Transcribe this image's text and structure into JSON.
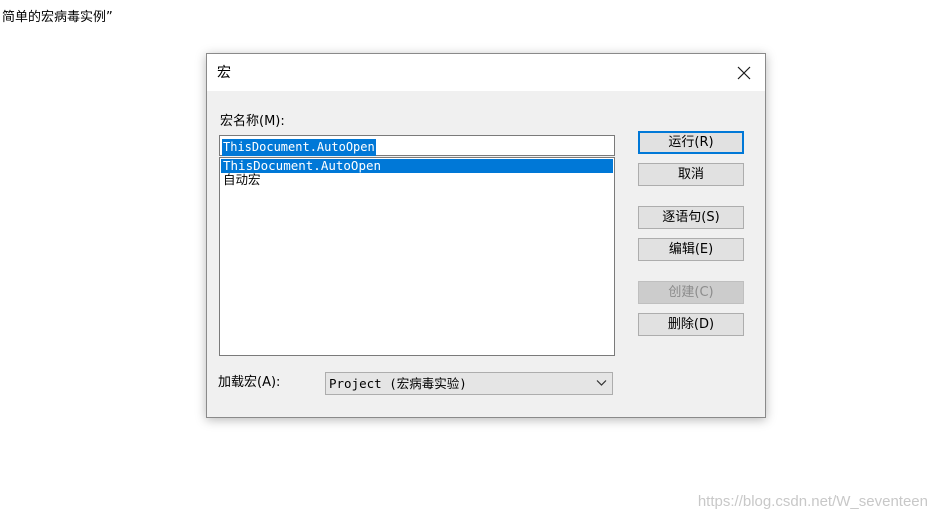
{
  "page": {
    "caption": "简单的宏病毒实例”",
    "watermark": "https://blog.csdn.net/W_seventeen"
  },
  "dialog": {
    "title": "宏",
    "close_icon": "close-icon",
    "macro_name_label": "宏名称(M):",
    "macro_name_value": "ThisDocument.AutoOpen",
    "macro_list": [
      {
        "label": "ThisDocument.AutoOpen",
        "selected": true
      },
      {
        "label": "自动宏",
        "selected": false
      }
    ],
    "buttons": {
      "run": "运行(R)",
      "cancel": "取消",
      "step_into": "逐语句(S)",
      "edit": "编辑(E)",
      "create": "创建(C)",
      "delete": "删除(D)"
    },
    "load_label": "加载宏(A):",
    "load_value": "Project (宏病毒实验)",
    "load_chevron_icon": "chevron-down-icon"
  },
  "colors": {
    "selection": "#0078d7",
    "dialog_bg": "#f0f0f0",
    "button_bg": "#e1e1e1",
    "disabled_text": "#8c8c8c"
  }
}
